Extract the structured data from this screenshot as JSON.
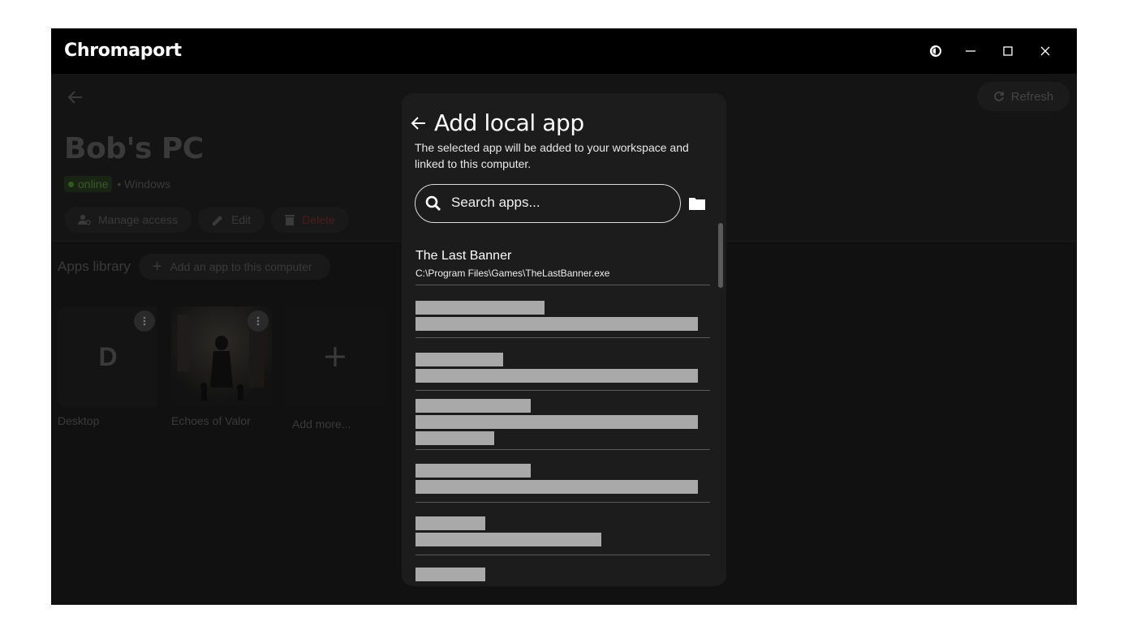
{
  "window": {
    "app_title": "Chromaport",
    "controls": {
      "theme_icon": "theme-toggle-icon",
      "minimize_icon": "minimize-icon",
      "maximize_icon": "maximize-icon",
      "close_icon": "close-icon"
    }
  },
  "topbar": {
    "back_icon": "arrow-left-icon",
    "refresh_label": "Refresh"
  },
  "computer": {
    "name": "Bob's PC",
    "status": "online",
    "os": "• Windows",
    "actions": {
      "manage_access": "Manage access",
      "edit": "Edit",
      "delete": "Delete"
    }
  },
  "library": {
    "title": "Apps library",
    "add_button": "Add an app to this computer",
    "tiles": [
      {
        "letter": "D",
        "label": "Desktop"
      },
      {
        "label": "Echoes of Valor"
      },
      {
        "label": "Add more..."
      }
    ]
  },
  "modal": {
    "title": "Add local app",
    "description": "The selected app will be added to your workspace and linked to this computer.",
    "search_placeholder": "Search apps...",
    "folder_icon": "folder-icon",
    "items": [
      {
        "title": "The Last Banner",
        "path": "C:\\Program Files\\Games\\TheLastBanner.exe"
      }
    ]
  },
  "colors": {
    "window_bg": "#000000",
    "modal_bg": "#1c1c1c",
    "skeleton": "#a9a9a9",
    "online_green": "#2e5a1e",
    "delete_red": "#4a1c1c"
  }
}
